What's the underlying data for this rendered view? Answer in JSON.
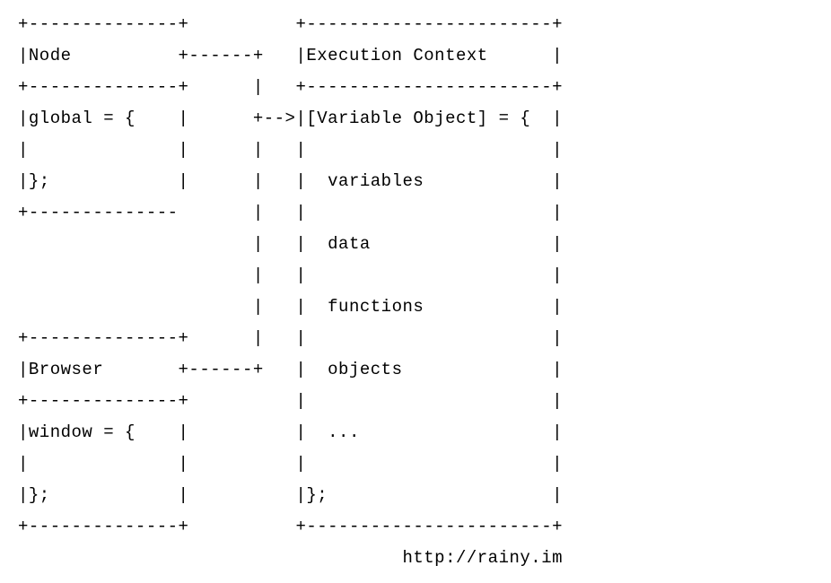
{
  "diagram": {
    "left_boxes": [
      {
        "title": "Node",
        "body_lines": [
          "global = {",
          "",
          "};"
        ]
      },
      {
        "title": "Browser",
        "body_lines": [
          "window = {",
          "",
          "};"
        ]
      }
    ],
    "right_box": {
      "title": "Execution Context",
      "body_lines": [
        "[Variable Object] = {",
        "",
        "  variables",
        "",
        "  data",
        "",
        "  functions",
        "",
        "  objects",
        "",
        "  ...",
        "",
        "};"
      ]
    },
    "arrow": "-->",
    "footer_url": "http://rainy.im"
  },
  "rendered_lines": [
    "+--------------+          +-----------------------+",
    "|Node          +------+   |Execution Context      |",
    "+--------------+      |   +-----------------------+",
    "|global = {    |      +-->|[Variable Object] = {  |",
    "|              |      |   |                       |",
    "|};            |      |   |  variables            |",
    "+--------------       |   |                       |",
    "                      |   |  data                 |",
    "                      |   |                       |",
    "                      |   |  functions            |",
    "+--------------+      |   |                       |",
    "|Browser       +------+   |  objects              |",
    "+--------------+          |                       |",
    "|window = {    |          |  ...                  |",
    "|              |          |                       |",
    "|};            |          |};                     |",
    "+--------------+          +-----------------------+",
    "                                    http://rainy.im"
  ]
}
